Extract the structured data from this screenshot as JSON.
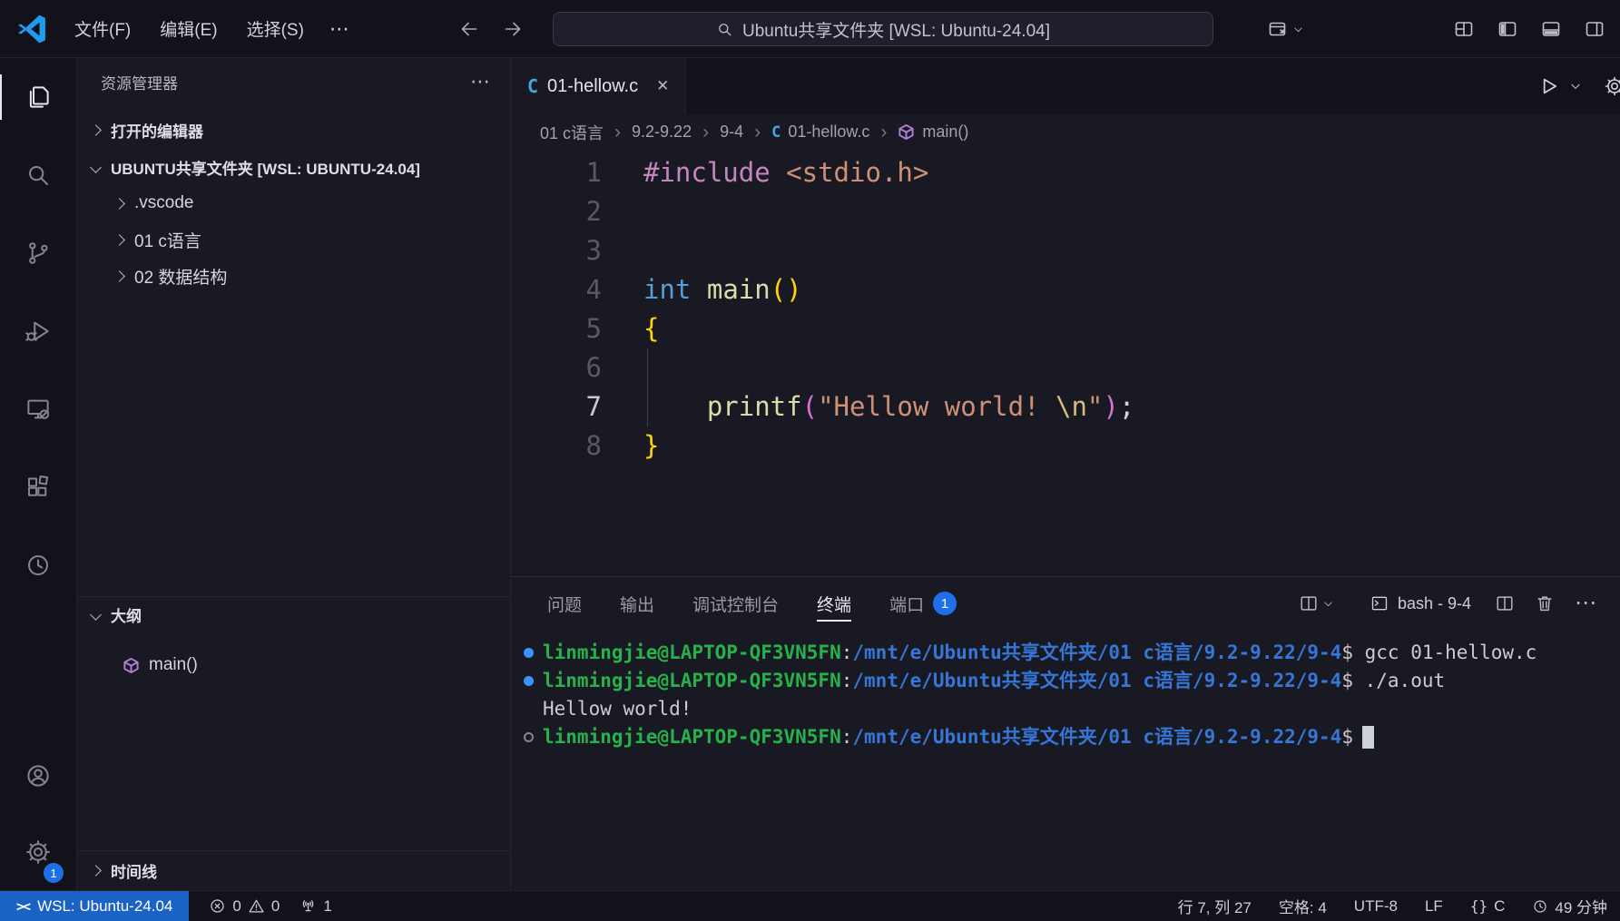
{
  "titlebar": {
    "menus": [
      "文件(F)",
      "编辑(E)",
      "选择(S)"
    ],
    "more_label": "⋯",
    "search_text": "Ubuntu共享文件夹 [WSL: Ubuntu-24.04]"
  },
  "sidebar": {
    "title": "资源管理器",
    "more_label": "⋯",
    "open_editors_label": "打开的编辑器",
    "root_label": "UBUNTU共享文件夹 [WSL: UBUNTU-24.04]",
    "folders": [
      ".vscode",
      "01 c语言",
      "02 数据结构"
    ],
    "outline_label": "大纲",
    "outline_items": [
      "main()"
    ],
    "timeline_label": "时间线"
  },
  "editor": {
    "tab": {
      "label": "01-hellow.c",
      "close_label": "✕"
    },
    "breadcrumbs": [
      {
        "label": "01 c语言"
      },
      {
        "label": "9.2-9.22"
      },
      {
        "label": "9-4"
      },
      {
        "label": "01-hellow.c",
        "icon": "c-file"
      },
      {
        "label": "main()",
        "icon": "symbol-method"
      }
    ],
    "code_lines": [
      {
        "n": "1",
        "tokens": [
          {
            "t": "#include",
            "c": "keyword"
          },
          {
            "t": " ",
            "c": "plain"
          },
          {
            "t": "<stdio.h>",
            "c": "string"
          }
        ]
      },
      {
        "n": "2",
        "tokens": []
      },
      {
        "n": "3",
        "tokens": []
      },
      {
        "n": "4",
        "tokens": [
          {
            "t": "int",
            "c": "type"
          },
          {
            "t": " ",
            "c": "plain"
          },
          {
            "t": "main",
            "c": "func"
          },
          {
            "t": "()",
            "c": "bracket1"
          }
        ]
      },
      {
        "n": "5",
        "tokens": [
          {
            "t": "{",
            "c": "bracket1"
          }
        ]
      },
      {
        "n": "6",
        "tokens": []
      },
      {
        "n": "7",
        "active": true,
        "tokens": [
          {
            "t": "    ",
            "c": "plain"
          },
          {
            "t": "printf",
            "c": "func"
          },
          {
            "t": "(",
            "c": "bracket2"
          },
          {
            "t": "\"Hellow world! ",
            "c": "string"
          },
          {
            "t": "\\n",
            "c": "escape"
          },
          {
            "t": "\"",
            "c": "string"
          },
          {
            "t": ")",
            "c": "bracket2"
          },
          {
            "t": ";",
            "c": "plain"
          }
        ]
      },
      {
        "n": "8",
        "tokens": [
          {
            "t": "}",
            "c": "bracket1"
          }
        ]
      }
    ]
  },
  "panel": {
    "tabs": [
      {
        "label": "问题"
      },
      {
        "label": "输出"
      },
      {
        "label": "调试控制台"
      },
      {
        "label": "终端",
        "active": true
      },
      {
        "label": "端口",
        "badge": "1"
      }
    ],
    "terminal_title": "bash - 9-4",
    "terminal": {
      "user": "linmingjie@LAPTOP-QF3VN5FN",
      "path": "/mnt/e/Ubuntu共享文件夹/01 c语言/9.2-9.22/9-4",
      "lines": [
        {
          "type": "command",
          "command": "gcc 01-hellow.c"
        },
        {
          "type": "command",
          "command": "./a.out"
        },
        {
          "type": "output",
          "text": "Hellow world!"
        },
        {
          "type": "prompt"
        }
      ]
    }
  },
  "statusbar": {
    "remote": "WSL: Ubuntu-24.04",
    "remote_glyph": "><",
    "errors": "0",
    "warnings": "0",
    "ports": "1",
    "cursor": "行 7, 列 27",
    "indent": "空格: 4",
    "encoding": "UTF-8",
    "eol": "LF",
    "language": "C",
    "timer": "49 分钟"
  },
  "icons": {
    "c_file": "C",
    "breadcrumb_separator": "›",
    "more_dots": "⋯",
    "braces": "{}"
  },
  "colors": {
    "accent": "#3794ff",
    "remote_bg": "#1a63c4",
    "ports_badge_bg": "#1f6feb",
    "terminal_green": "#26b24b",
    "terminal_blue": "#3576d6",
    "bracket_gold": "#ffd700",
    "bracket_pink": "#da70d6"
  }
}
